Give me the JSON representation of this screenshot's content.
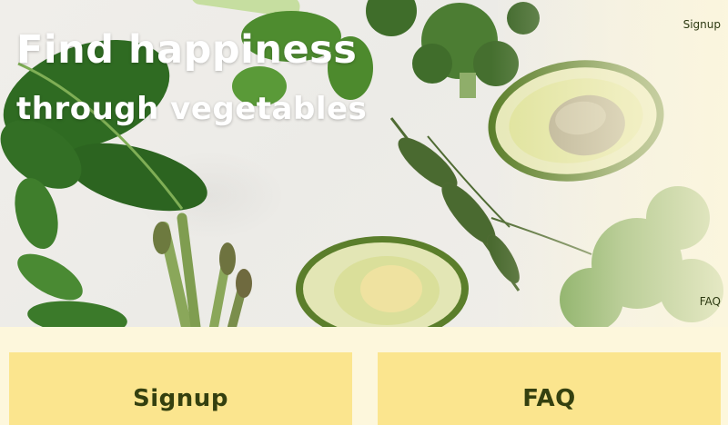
{
  "hero": {
    "headline_line1": "Find happiness",
    "headline_line2": "through vegetables"
  },
  "nav": {
    "signup_label": "Signup",
    "faq_label": "FAQ"
  },
  "cards": {
    "signup_label": "Signup",
    "faq_label": "FAQ"
  },
  "colors": {
    "page_background": "#fdf7dc",
    "card_background": "#fbe58e",
    "card_text": "#34400f",
    "headline_text": "#ffffff"
  }
}
